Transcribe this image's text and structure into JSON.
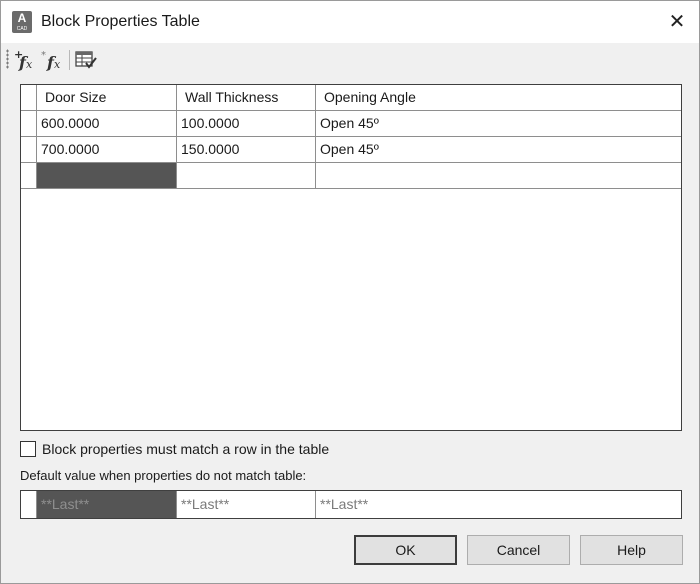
{
  "window": {
    "title": "Block Properties Table",
    "app_icon_letter": "A",
    "app_icon_sub": "CAD",
    "close_glyph": "✕"
  },
  "toolbar": {
    "icons": [
      "add-user-parameter-icon",
      "add-property-icon",
      "audit-table-icon"
    ]
  },
  "table": {
    "columns": [
      "Door Size",
      "Wall Thickness",
      "Opening Angle"
    ],
    "rows": [
      [
        "600.0000",
        "100.0000",
        "Open 45º"
      ],
      [
        "700.0000",
        "150.0000",
        "Open 45º"
      ]
    ]
  },
  "options": {
    "must_match_label": "Block properties must match a row in the table",
    "must_match_checked": false,
    "default_value_label": "Default value when properties do not match table:",
    "defaults": [
      "**Last**",
      "**Last**",
      "**Last**"
    ]
  },
  "buttons": {
    "ok": "OK",
    "cancel": "Cancel",
    "help": "Help"
  }
}
